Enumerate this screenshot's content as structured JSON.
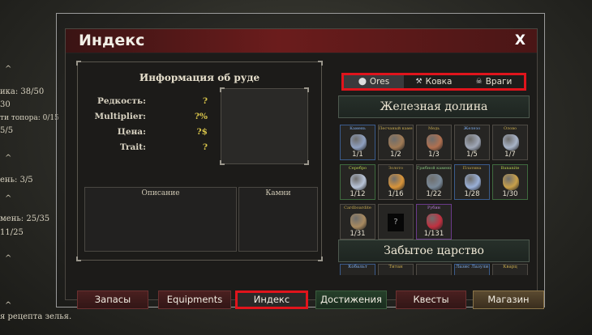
{
  "background": {
    "side_lines": [
      {
        "text": "ика: 38/50",
        "top": 0
      },
      {
        "text": "30",
        "top": 0
      },
      {
        "text": "ти топора: 0/15",
        "top": 0
      },
      {
        "text": "5/5",
        "top": 0
      },
      {
        "text": "ень: 3/5",
        "top": 0
      },
      {
        "text": "мень: 25/35",
        "top": 0
      },
      {
        "text": "11/25",
        "top": 0
      }
    ],
    "bottom_text": "я рецепта зелья."
  },
  "window": {
    "title": "Индекс",
    "close_label": "X"
  },
  "info": {
    "title": "Информация об руде",
    "stats": [
      {
        "label": "Редкость:",
        "value": "?"
      },
      {
        "label": "Multiplier:",
        "value": "?%"
      },
      {
        "label": "Цена:",
        "value": "?$"
      },
      {
        "label": "Trait:",
        "value": "?"
      }
    ],
    "description_label": "Описание",
    "stones_label": "Камни"
  },
  "tabs": [
    {
      "label": "Ores",
      "icon": "circle-icon",
      "glyph": "⬤",
      "active": true
    },
    {
      "label": "Ковка",
      "icon": "hammer-icon",
      "glyph": "⚒",
      "active": false
    },
    {
      "label": "Враги",
      "icon": "skull-icon",
      "glyph": "☠",
      "active": false
    }
  ],
  "regions": [
    {
      "name": "Железная долина"
    },
    {
      "name": "Забытое царство"
    }
  ],
  "ores": [
    {
      "name": "Камень",
      "count": "1/1",
      "color": "#8fa0c0",
      "name_style": "blue",
      "tile_style": "blue"
    },
    {
      "name": "Песчаный камень",
      "count": "1/2",
      "color": "#a07a55",
      "name_style": "",
      "tile_style": ""
    },
    {
      "name": "Медь",
      "count": "1/3",
      "color": "#b07050",
      "name_style": "",
      "tile_style": ""
    },
    {
      "name": "Железо",
      "count": "1/5",
      "color": "#a0a8b8",
      "name_style": "blue",
      "tile_style": ""
    },
    {
      "name": "Олово",
      "count": "1/7",
      "color": "#a8b4c8",
      "name_style": "",
      "tile_style": ""
    },
    {
      "name": "Серебро",
      "count": "1/12",
      "color": "#b8c4d8",
      "name_style": "lime",
      "tile_style": "green"
    },
    {
      "name": "Золото",
      "count": "1/16",
      "color": "#d8943a",
      "name_style": "",
      "tile_style": ""
    },
    {
      "name": "Грибной камень",
      "count": "1/22",
      "color": "#7a8a9a",
      "name_style": "green",
      "tile_style": ""
    },
    {
      "name": "Платина",
      "count": "1/28",
      "color": "#9ab0d8",
      "name_style": "",
      "tile_style": "blue"
    },
    {
      "name": "Bananite",
      "count": "1/30",
      "color": "#c8a04a",
      "name_style": "lime",
      "tile_style": "green"
    },
    {
      "name": "Cardboardite",
      "count": "1/31",
      "color": "#a88a60",
      "name_style": "",
      "tile_style": ""
    },
    {
      "name": "",
      "count": "",
      "color": "",
      "name_style": "",
      "tile_style": "",
      "unknown": true,
      "unknown_glyph": "?"
    },
    {
      "name": "Рубин",
      "count": "1/131",
      "color": "#c03040",
      "name_style": "purple",
      "tile_style": "purple"
    }
  ],
  "second_region_ores": [
    {
      "name": "Кобальт",
      "style": "blue"
    },
    {
      "name": "Титан",
      "style": ""
    },
    {
      "name": "",
      "style": ""
    },
    {
      "name": "Лазис Лазули",
      "style": "blue"
    },
    {
      "name": "Кварц",
      "style": ""
    }
  ],
  "nav": [
    {
      "label": "Запасы",
      "style": "red"
    },
    {
      "label": "Equipments",
      "style": "red"
    },
    {
      "label": "Индекс",
      "style": "sel"
    },
    {
      "label": "Достижения",
      "style": "green"
    },
    {
      "label": "Квесты",
      "style": "red"
    },
    {
      "label": "Магазин",
      "style": "gold"
    }
  ]
}
